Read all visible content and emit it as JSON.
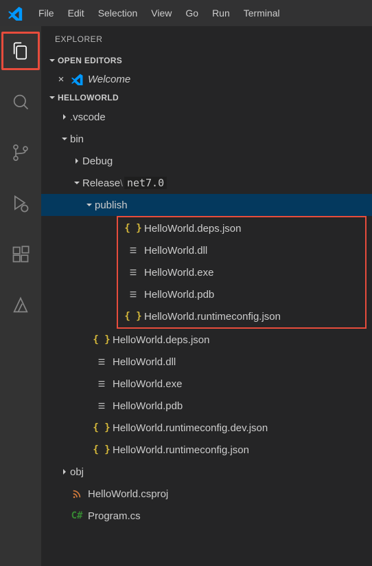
{
  "menu": [
    "File",
    "Edit",
    "Selection",
    "View",
    "Go",
    "Run",
    "Terminal"
  ],
  "explorer": {
    "title": "EXPLORER",
    "openEditors": {
      "label": "OPEN EDITORS",
      "items": [
        {
          "label": "Welcome",
          "italic": true
        }
      ]
    },
    "workspace": {
      "name": "HELLOWORLD",
      "tree": [
        {
          "type": "folder",
          "label": ".vscode",
          "expanded": false,
          "indent": 1
        },
        {
          "type": "folder",
          "label": "bin",
          "expanded": true,
          "indent": 1
        },
        {
          "type": "folder",
          "label": "Debug",
          "expanded": false,
          "indent": 2
        },
        {
          "type": "folder",
          "label": "Release",
          "pathSuffix": "net7.0",
          "expanded": true,
          "indent": 2
        },
        {
          "type": "folder",
          "label": "publish",
          "expanded": true,
          "indent": 3,
          "selected": true
        },
        {
          "type": "file",
          "label": "HelloWorld.deps.json",
          "icon": "json",
          "indent": 4,
          "highlighted": true
        },
        {
          "type": "file",
          "label": "HelloWorld.dll",
          "icon": "file",
          "indent": 4,
          "highlighted": true
        },
        {
          "type": "file",
          "label": "HelloWorld.exe",
          "icon": "file",
          "indent": 4,
          "highlighted": true
        },
        {
          "type": "file",
          "label": "HelloWorld.pdb",
          "icon": "file",
          "indent": 4,
          "highlighted": true
        },
        {
          "type": "file",
          "label": "HelloWorld.runtimeconfig.json",
          "icon": "json",
          "indent": 4,
          "highlighted": true
        },
        {
          "type": "file",
          "label": "HelloWorld.deps.json",
          "icon": "json",
          "indent": 3
        },
        {
          "type": "file",
          "label": "HelloWorld.dll",
          "icon": "file",
          "indent": 3
        },
        {
          "type": "file",
          "label": "HelloWorld.exe",
          "icon": "file",
          "indent": 3
        },
        {
          "type": "file",
          "label": "HelloWorld.pdb",
          "icon": "file",
          "indent": 3
        },
        {
          "type": "file",
          "label": "HelloWorld.runtimeconfig.dev.json",
          "icon": "json",
          "indent": 3
        },
        {
          "type": "file",
          "label": "HelloWorld.runtimeconfig.json",
          "icon": "json",
          "indent": 3
        },
        {
          "type": "folder",
          "label": "obj",
          "expanded": false,
          "indent": 1
        },
        {
          "type": "file",
          "label": "HelloWorld.csproj",
          "icon": "rss",
          "indent": 1
        },
        {
          "type": "file",
          "label": "Program.cs",
          "icon": "cs",
          "indent": 1
        }
      ]
    }
  }
}
